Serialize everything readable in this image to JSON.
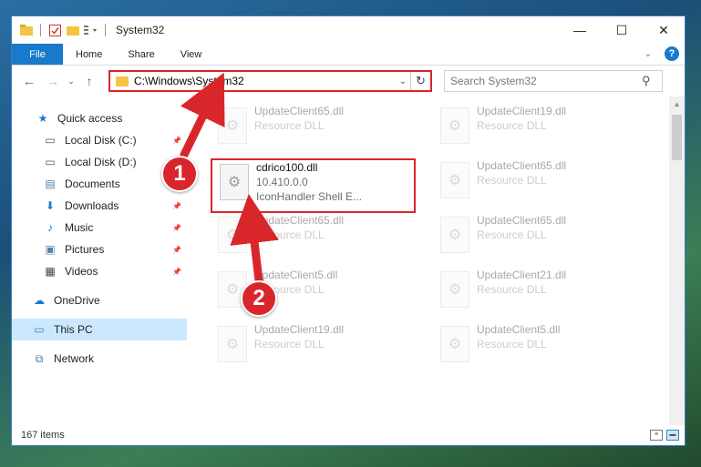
{
  "window": {
    "title": "System32",
    "controls": {
      "minimize": "—",
      "maximize": "☐",
      "close": "✕"
    }
  },
  "ribbon": {
    "tabs": [
      "File",
      "Home",
      "Share",
      "View"
    ],
    "help": "?"
  },
  "nav": {
    "back": "←",
    "forward": "→",
    "up": "↑",
    "address": "C:\\Windows\\System32",
    "search_placeholder": "Search System32"
  },
  "sidebar": {
    "items": [
      {
        "label": "Quick access",
        "icon": "star-icon",
        "glyph": "★",
        "color": "#1979ca",
        "pinned": false
      },
      {
        "label": "Local Disk (C:)",
        "icon": "drive-icon",
        "glyph": "▭",
        "color": "#555555",
        "pinned": true
      },
      {
        "label": "Local Disk (D:)",
        "icon": "drive-icon",
        "glyph": "▭",
        "color": "#555555",
        "pinned": true
      },
      {
        "label": "Documents",
        "icon": "documents-icon",
        "glyph": "▤",
        "color": "#5a7fa8",
        "pinned": true
      },
      {
        "label": "Downloads",
        "icon": "download-icon",
        "glyph": "⬇",
        "color": "#1979ca",
        "pinned": true
      },
      {
        "label": "Music",
        "icon": "music-icon",
        "glyph": "♪",
        "color": "#1979ca",
        "pinned": true
      },
      {
        "label": "Pictures",
        "icon": "pictures-icon",
        "glyph": "▣",
        "color": "#5a7fa8",
        "pinned": true
      },
      {
        "label": "Videos",
        "icon": "videos-icon",
        "glyph": "▦",
        "color": "#444444",
        "pinned": true
      }
    ],
    "onedrive": "OneDrive",
    "thispc": "This PC",
    "network": "Network"
  },
  "files": {
    "highlighted": {
      "name": "cdrico100.dll",
      "version": "10.410.0.0",
      "description": "IconHandler Shell E..."
    },
    "background": [
      {
        "name": "UpdateClient65.dll",
        "type": "Resource DLL"
      },
      {
        "name": "UpdateClient19.dll",
        "type": "Resource DLL"
      },
      {
        "name": "UpdateClient65.dll",
        "type": "Resource DLL"
      },
      {
        "name": "UpdateClient65.dll",
        "type": "Resource DLL"
      },
      {
        "name": "UpdateClient65.dll",
        "type": "Resource DLL"
      },
      {
        "name": "UpdateClient5.dll",
        "type": "Resource DLL"
      },
      {
        "name": "UpdateClient21.dll",
        "type": "Resource DLL"
      },
      {
        "name": "UpdateClient19.dll",
        "type": "Resource DLL"
      },
      {
        "name": "UpdateClient5.dll",
        "type": "Resource DLL"
      }
    ]
  },
  "status": {
    "count": "167 items"
  },
  "annotations": {
    "step1": "1",
    "step2": "2",
    "accent": "#d9262b"
  }
}
